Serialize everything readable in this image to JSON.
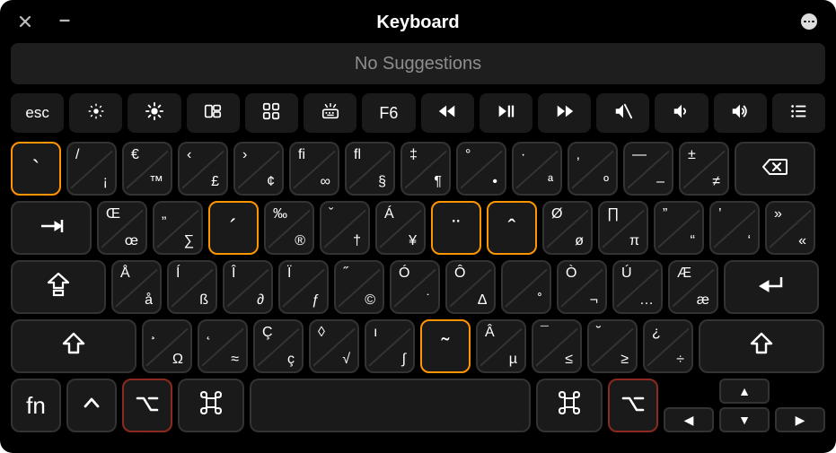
{
  "window": {
    "title": "Keyboard"
  },
  "suggestion_bar": {
    "text": "No Suggestions"
  },
  "fn_row": [
    {
      "id": "esc",
      "label": "esc",
      "icon": null,
      "interactable": true
    },
    {
      "id": "brightness-down",
      "label": "",
      "icon": "brightness-low",
      "interactable": true
    },
    {
      "id": "brightness-up",
      "label": "",
      "icon": "brightness-high",
      "interactable": true
    },
    {
      "id": "mission-control",
      "label": "",
      "icon": "mission-control",
      "interactable": true
    },
    {
      "id": "launchpad",
      "label": "",
      "icon": "launchpad",
      "interactable": true
    },
    {
      "id": "keyboard-backlight",
      "label": "",
      "icon": "keyboard-light",
      "interactable": true
    },
    {
      "id": "f6",
      "label": "F6",
      "icon": null,
      "interactable": true
    },
    {
      "id": "rewind",
      "label": "",
      "icon": "rewind",
      "interactable": true
    },
    {
      "id": "play-pause",
      "label": "",
      "icon": "play-pause",
      "interactable": true
    },
    {
      "id": "fast-forward",
      "label": "",
      "icon": "fast-forward",
      "interactable": true
    },
    {
      "id": "mute",
      "label": "",
      "icon": "mute",
      "interactable": true
    },
    {
      "id": "volume-down",
      "label": "",
      "icon": "volume-down",
      "interactable": true
    },
    {
      "id": "volume-up",
      "label": "",
      "icon": "volume-up",
      "interactable": true
    },
    {
      "id": "list",
      "label": "",
      "icon": "list",
      "interactable": true
    }
  ],
  "rows": {
    "r1": [
      {
        "type": "std",
        "w": "u1",
        "label": "`",
        "highlight": true,
        "name": "key-grave",
        "sup": ""
      },
      {
        "type": "split",
        "w": "u1",
        "tl": "/",
        "br": "¡",
        "name": "key-1"
      },
      {
        "type": "split",
        "w": "u1",
        "tl": "€",
        "br": "™",
        "name": "key-2"
      },
      {
        "type": "split",
        "w": "u1",
        "tl": "‹",
        "br": "£",
        "name": "key-3"
      },
      {
        "type": "split",
        "w": "u1",
        "tl": "›",
        "br": "¢",
        "name": "key-4"
      },
      {
        "type": "split",
        "w": "u1",
        "tl": "ﬁ",
        "br": "∞",
        "name": "key-5"
      },
      {
        "type": "split",
        "w": "u1",
        "tl": "ﬂ",
        "br": "§",
        "name": "key-6"
      },
      {
        "type": "split",
        "w": "u1",
        "tl": "‡",
        "br": "¶",
        "name": "key-7"
      },
      {
        "type": "split",
        "w": "u1",
        "tl": "°",
        "br": "•",
        "name": "key-8"
      },
      {
        "type": "split",
        "w": "u1",
        "tl": "·",
        "br": "ª",
        "name": "key-9"
      },
      {
        "type": "split",
        "w": "u1",
        "tl": "‚",
        "br": "º",
        "name": "key-0"
      },
      {
        "type": "split",
        "w": "u1",
        "tl": "—",
        "br": "–",
        "name": "key-minus"
      },
      {
        "type": "split",
        "w": "u1",
        "tl": "±",
        "br": "≠",
        "name": "key-equals"
      },
      {
        "type": "icon",
        "w": "u15",
        "icon": "delete",
        "name": "key-delete"
      }
    ],
    "r2": [
      {
        "type": "icon",
        "w": "u15",
        "icon": "tab",
        "name": "key-tab"
      },
      {
        "type": "split",
        "w": "u1",
        "tl": "Œ",
        "br": "œ",
        "name": "key-q"
      },
      {
        "type": "split",
        "w": "u1",
        "tl": "„",
        "br": "∑",
        "name": "key-w"
      },
      {
        "type": "std",
        "w": "u1",
        "label": "´",
        "highlight": true,
        "name": "key-e"
      },
      {
        "type": "split",
        "w": "u1",
        "tl": "‰",
        "br": "®",
        "name": "key-r"
      },
      {
        "type": "split",
        "w": "u1",
        "tl": "ˇ",
        "br": "†",
        "name": "key-t"
      },
      {
        "type": "split",
        "w": "u1",
        "tl": "Á",
        "br": "¥",
        "name": "key-y"
      },
      {
        "type": "std",
        "w": "u1",
        "label": "¨",
        "highlight": true,
        "name": "key-u"
      },
      {
        "type": "std",
        "w": "u1",
        "label": "ˆ",
        "highlight": true,
        "name": "key-i"
      },
      {
        "type": "split",
        "w": "u1",
        "tl": "Ø",
        "br": "ø",
        "name": "key-o"
      },
      {
        "type": "split",
        "w": "u1",
        "tl": "∏",
        "br": "π",
        "name": "key-p"
      },
      {
        "type": "split",
        "w": "u1",
        "tl": "”",
        "br": "“",
        "name": "key-lbracket"
      },
      {
        "type": "split",
        "w": "u1",
        "tl": "’",
        "br": "‘",
        "name": "key-rbracket"
      },
      {
        "type": "split",
        "w": "u1",
        "tl": "»",
        "br": "«",
        "name": "key-backslash"
      }
    ],
    "r3": [
      {
        "type": "icon",
        "w": "u175",
        "icon": "capslock",
        "name": "key-capslock"
      },
      {
        "type": "split",
        "w": "u1",
        "tl": "Å",
        "br": "å",
        "name": "key-a"
      },
      {
        "type": "split",
        "w": "u1",
        "tl": "Í",
        "br": "ß",
        "name": "key-s"
      },
      {
        "type": "split",
        "w": "u1",
        "tl": "Î",
        "br": "∂",
        "name": "key-d"
      },
      {
        "type": "split",
        "w": "u1",
        "tl": "Ï",
        "br": "ƒ",
        "name": "key-f"
      },
      {
        "type": "split",
        "w": "u1",
        "tl": "˝",
        "br": "©",
        "name": "key-g"
      },
      {
        "type": "split",
        "w": "u1",
        "tl": "Ó",
        "br": "˙",
        "name": "key-h"
      },
      {
        "type": "split",
        "w": "u1",
        "tl": "Ô",
        "br": "∆",
        "name": "key-j"
      },
      {
        "type": "split",
        "w": "u1",
        "tl": "",
        "br": "˚",
        "name": "key-k"
      },
      {
        "type": "split",
        "w": "u1",
        "tl": "Ò",
        "br": "¬",
        "name": "key-l"
      },
      {
        "type": "split",
        "w": "u1",
        "tl": "Ú",
        "br": "…",
        "name": "key-semicolon"
      },
      {
        "type": "split",
        "w": "u1",
        "tl": "Æ",
        "br": "æ",
        "name": "key-quote"
      },
      {
        "type": "icon",
        "w": "u175",
        "icon": "return",
        "name": "key-return"
      }
    ],
    "r4": [
      {
        "type": "icon",
        "w": "u225",
        "icon": "shift",
        "name": "key-left-shift"
      },
      {
        "type": "split",
        "w": "u1",
        "tl": "¸",
        "br": "Ω",
        "name": "key-z"
      },
      {
        "type": "split",
        "w": "u1",
        "tl": "˛",
        "br": "≈",
        "name": "key-x"
      },
      {
        "type": "split",
        "w": "u1",
        "tl": "Ç",
        "br": "ç",
        "name": "key-c"
      },
      {
        "type": "split",
        "w": "u1",
        "tl": "◊",
        "br": "√",
        "name": "key-v"
      },
      {
        "type": "split",
        "w": "u1",
        "tl": "ı",
        "br": "∫",
        "name": "key-b"
      },
      {
        "type": "std",
        "w": "u1",
        "label": "˜",
        "highlight": true,
        "name": "key-n"
      },
      {
        "type": "split",
        "w": "u1",
        "tl": "Â",
        "br": "µ",
        "name": "key-m"
      },
      {
        "type": "split",
        "w": "u1",
        "tl": "¯",
        "br": "≤",
        "name": "key-comma"
      },
      {
        "type": "split",
        "w": "u1",
        "tl": "˘",
        "br": "≥",
        "name": "key-period"
      },
      {
        "type": "split",
        "w": "u1",
        "tl": "¿",
        "br": "÷",
        "name": "key-slash"
      },
      {
        "type": "icon",
        "w": "u225",
        "icon": "shift",
        "name": "key-right-shift"
      }
    ],
    "r5_left": [
      {
        "type": "text",
        "w": "u1",
        "label": "fn",
        "name": "key-fn"
      },
      {
        "type": "icon",
        "w": "u1",
        "icon": "control",
        "name": "key-control"
      },
      {
        "type": "icon",
        "w": "u1",
        "icon": "option",
        "name": "key-left-option",
        "opt": true
      },
      {
        "type": "icon",
        "w": "u125",
        "icon": "command",
        "name": "key-left-command"
      }
    ],
    "r5_right": [
      {
        "type": "icon",
        "w": "u125",
        "icon": "command",
        "name": "key-right-command"
      },
      {
        "type": "icon",
        "w": "u1",
        "icon": "option",
        "name": "key-right-option",
        "opt": true
      }
    ],
    "arrows": {
      "up": "▲",
      "down": "▼",
      "left": "◀",
      "right": "▶"
    }
  }
}
